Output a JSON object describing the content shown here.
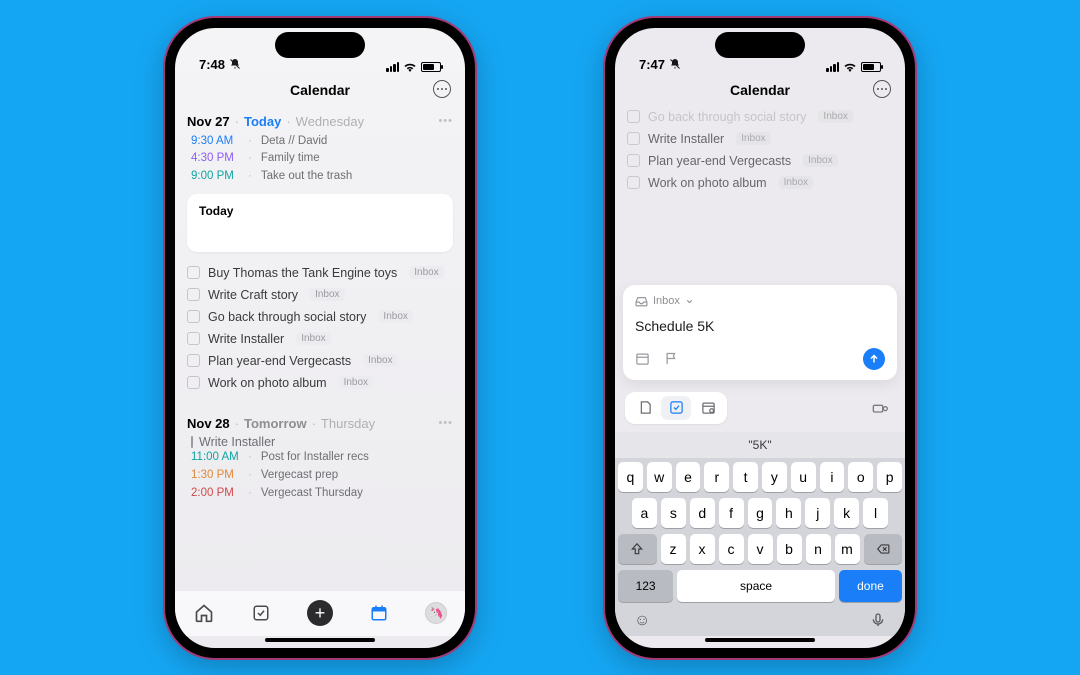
{
  "left": {
    "status_time": "7:48",
    "nav_title": "Calendar",
    "day1": {
      "date": "Nov 27",
      "label": "Today",
      "dow": "Wednesday",
      "events": [
        {
          "time": "9:30 AM",
          "title": "Deta // David",
          "color": "t-blue"
        },
        {
          "time": "4:30 PM",
          "title": "Family time",
          "color": "t-purple"
        },
        {
          "time": "9:00 PM",
          "title": "Take out the trash",
          "color": "t-teal"
        }
      ],
      "card_title": "Today",
      "tasks": [
        {
          "title": "Buy Thomas the Tank Engine toys",
          "tag": "Inbox"
        },
        {
          "title": "Write Craft story",
          "tag": "Inbox"
        },
        {
          "title": "Go back through social story",
          "tag": "Inbox"
        },
        {
          "title": "Write Installer",
          "tag": "Inbox"
        },
        {
          "title": "Plan year-end Vergecasts",
          "tag": "Inbox"
        },
        {
          "title": "Work on photo album",
          "tag": "Inbox"
        }
      ]
    },
    "day2": {
      "date": "Nov 28",
      "label": "Tomorrow",
      "dow": "Thursday",
      "top_task": "Write Installer",
      "events": [
        {
          "time": "11:00 AM",
          "title": "Post for Installer recs",
          "color": "t-teal"
        },
        {
          "time": "1:30 PM",
          "title": "Vergecast prep",
          "color": "t-orange"
        },
        {
          "time": "2:00 PM",
          "title": "Vergecast Thursday",
          "color": "t-red"
        }
      ]
    }
  },
  "right": {
    "status_time": "7:47",
    "nav_title": "Calendar",
    "bg_tasks": [
      {
        "title": "Go back through social story",
        "tag": "Inbox"
      },
      {
        "title": "Write Installer",
        "tag": "Inbox"
      },
      {
        "title": "Plan year-end Vergecasts",
        "tag": "Inbox"
      },
      {
        "title": "Work on photo album",
        "tag": "Inbox"
      }
    ],
    "compose": {
      "list_label": "Inbox",
      "title": "Schedule 5K"
    },
    "suggestion": "\"5K\"",
    "keys_r1": [
      "q",
      "w",
      "e",
      "r",
      "t",
      "y",
      "u",
      "i",
      "o",
      "p"
    ],
    "keys_r2": [
      "a",
      "s",
      "d",
      "f",
      "g",
      "h",
      "j",
      "k",
      "l"
    ],
    "keys_r3": [
      "z",
      "x",
      "c",
      "v",
      "b",
      "n",
      "m"
    ],
    "key_123": "123",
    "key_space": "space",
    "key_done": "done"
  }
}
